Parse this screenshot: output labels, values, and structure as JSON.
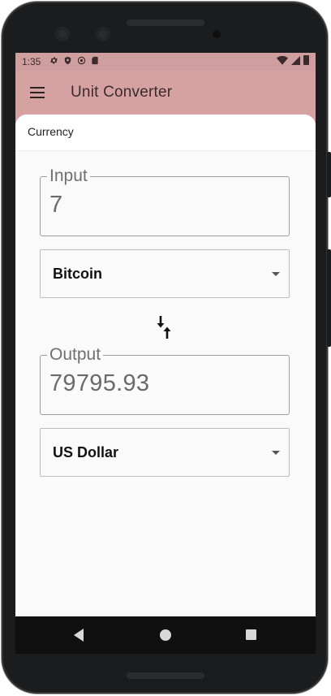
{
  "statusbar": {
    "time": "1:35",
    "left_icons": [
      "gear-icon",
      "shield-icon",
      "sync-icon",
      "sd-card-icon"
    ],
    "right_icons": [
      "wifi-icon",
      "signal-icon",
      "battery-icon"
    ]
  },
  "appbar": {
    "title": "Unit Converter",
    "menu_icon": "hamburger-menu-icon",
    "background": "#d6a1a1"
  },
  "category": {
    "label": "Currency"
  },
  "input": {
    "label": "Input",
    "value": "7"
  },
  "from_unit": {
    "selected": "Bitcoin"
  },
  "swap": {
    "icon": "swap-vertical-icon"
  },
  "output": {
    "label": "Output",
    "value": "79795.93"
  },
  "to_unit": {
    "selected": "US Dollar"
  },
  "navbar": {
    "buttons": [
      "back-icon",
      "home-icon",
      "recents-icon"
    ]
  }
}
